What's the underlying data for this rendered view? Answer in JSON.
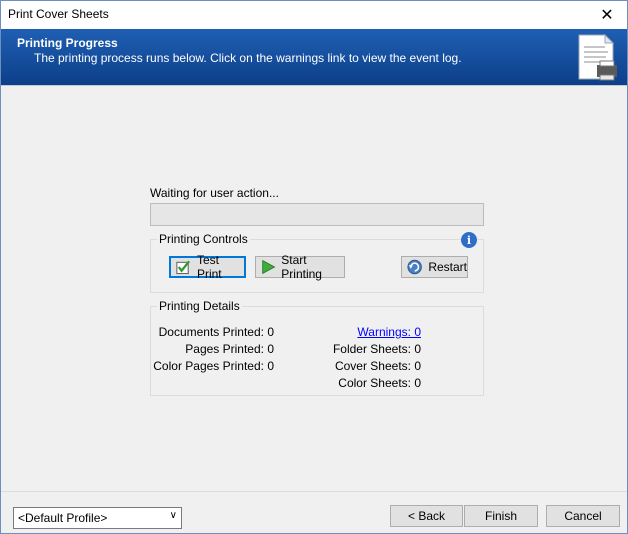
{
  "window": {
    "title": "Print Cover Sheets"
  },
  "banner": {
    "title": "Printing Progress",
    "subtitle": "The printing process runs below. Click on the warnings link to view the event log."
  },
  "status": {
    "text": "Waiting for user action...",
    "progress": 0
  },
  "controls": {
    "group_title": "Printing Controls",
    "test_print": "Test Print",
    "start_printing": "Start Printing",
    "restart": "Restart"
  },
  "details": {
    "group_title": "Printing Details",
    "left": [
      {
        "label": "Documents Printed: 0"
      },
      {
        "label": "Pages Printed: 0"
      },
      {
        "label": "Color Pages Printed: 0"
      }
    ],
    "right": [
      {
        "label": "Warnings: 0"
      },
      {
        "label": "Folder Sheets: 0"
      },
      {
        "label": "Cover Sheets: 0"
      },
      {
        "label": "Color Sheets: 0"
      }
    ]
  },
  "footer": {
    "profile": "<Default Profile>",
    "back": "< Back",
    "finish": "Finish",
    "cancel": "Cancel"
  },
  "colors": {
    "banner": "#0d3f8a",
    "accent": "#0078d7",
    "link": "#0000ff"
  }
}
